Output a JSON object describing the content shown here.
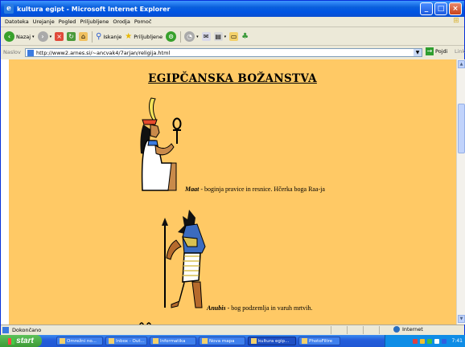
{
  "window": {
    "title": "kultura egipt - Microsoft Internet Explorer"
  },
  "menu": [
    "Datoteka",
    "Urejanje",
    "Pogled",
    "Priljubljene",
    "Orodja",
    "Pomoč"
  ],
  "toolbar": {
    "back_label": "Nazaj",
    "search_label": "Iskanje",
    "favorites_label": "Priljubljene"
  },
  "address": {
    "label": "Naslov",
    "url": "http://www2.arnes.si/~ancvak4/7arjan/religija.html",
    "go_label": "Pojdi",
    "links_label": "Links"
  },
  "page": {
    "heading": "EGIPČANSKA BOŽANSTVA",
    "items": [
      {
        "name": "Maat",
        "desc": " - boginja pravice in resnice. Hčerka boga Raa-ja"
      },
      {
        "name": "Anubis",
        "desc": " - bog podzemlja in varuh mrtvih."
      }
    ]
  },
  "statusbar": {
    "status": "Dokončano",
    "zone": "Internet"
  },
  "taskbar": {
    "start": "start",
    "tasks": [
      "Omrežni no...",
      "Inbox - Out...",
      "Informatika",
      "Nova mapa",
      "kultura egip...",
      "PhotoFiltre"
    ],
    "active_index": 4,
    "clock": "7:41"
  },
  "colors": {
    "page_background": "#ffc965",
    "titlebar": "#0054e3",
    "taskbar": "#245edb",
    "start_button": "#3c9a36"
  }
}
